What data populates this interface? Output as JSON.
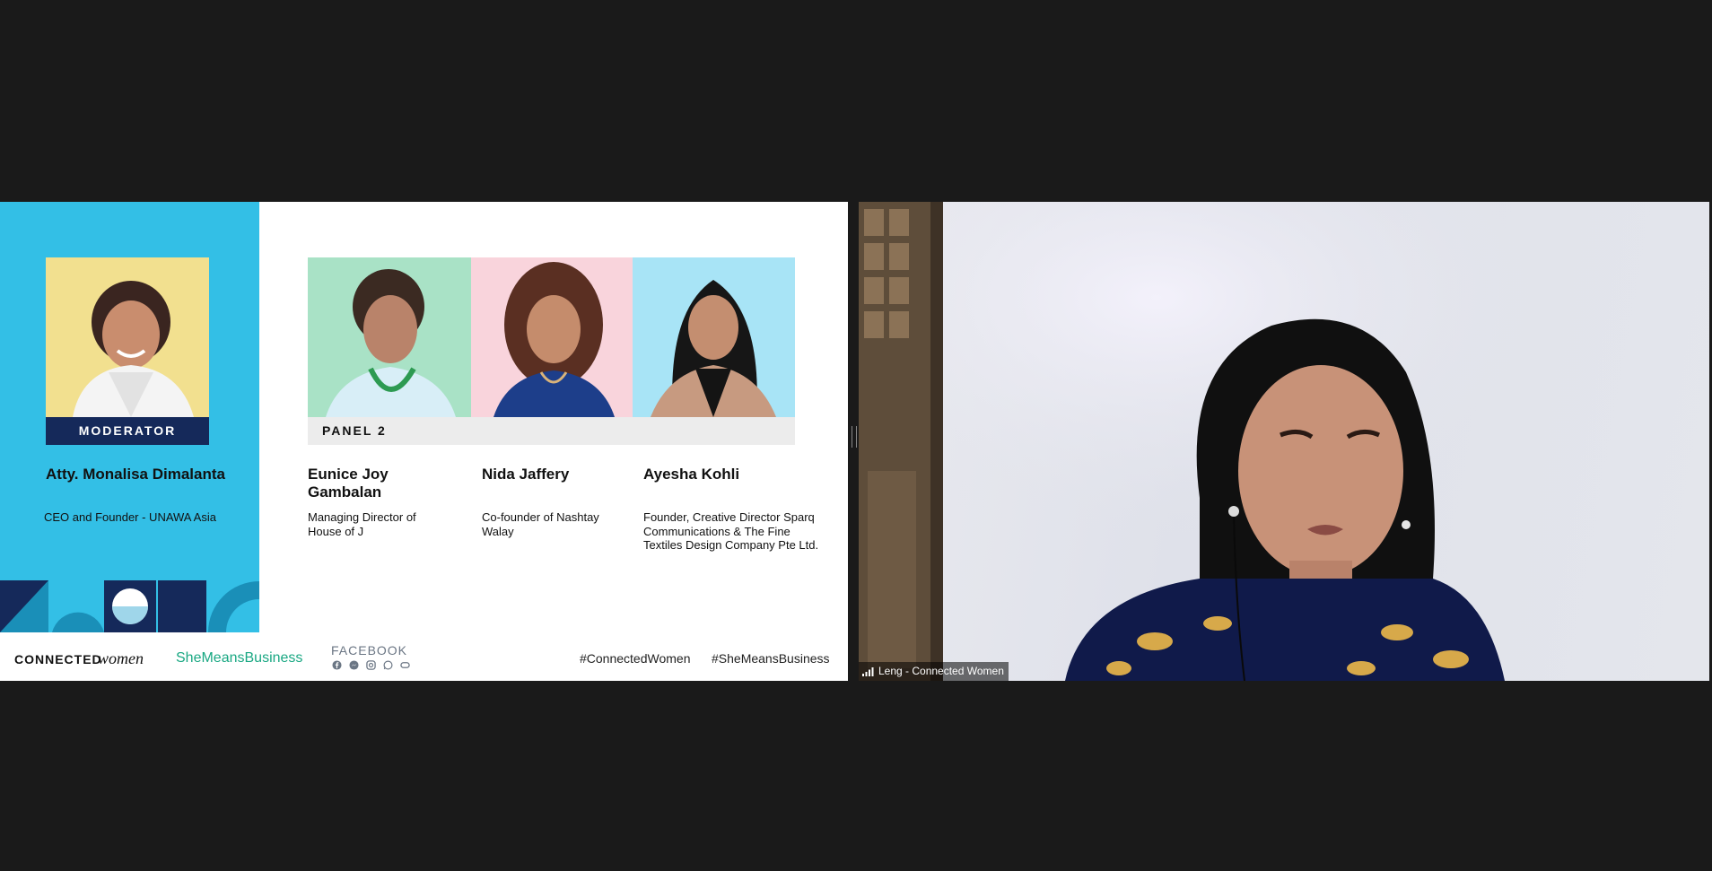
{
  "slide": {
    "moderator": {
      "label": "MODERATOR",
      "name": "Atty. Monalisa Dimalanta",
      "role": "CEO and Founder - UNAWA Asia"
    },
    "panel": {
      "label": "PANEL 2",
      "panelists": [
        {
          "name": "Eunice Joy Gambalan",
          "role": "Managing Director of House of J"
        },
        {
          "name": "Nida Jaffery",
          "role": "Co-founder of Nashtay Walay"
        },
        {
          "name": "Ayesha Kohli",
          "role": "Founder, Creative Director Sparq Communications & The Fine Textiles Design Company Pte Ltd."
        }
      ]
    },
    "footer": {
      "brand_caps": "CONNECTED",
      "brand_script": "women",
      "campaign": "SheMeansBusiness",
      "social_label": "FACEBOOK",
      "social_icons": [
        "facebook-icon",
        "messenger-icon",
        "instagram-icon",
        "whatsapp-icon",
        "messenger-rooms-icon"
      ],
      "hashtag_1": "#ConnectedWomen",
      "hashtag_2": "#SheMeansBusiness"
    },
    "colors": {
      "left_panel": "#33bfe6",
      "navy": "#15295a",
      "accent_green": "#1aa883"
    }
  },
  "video": {
    "participant_name": "Leng - Connected Women"
  }
}
